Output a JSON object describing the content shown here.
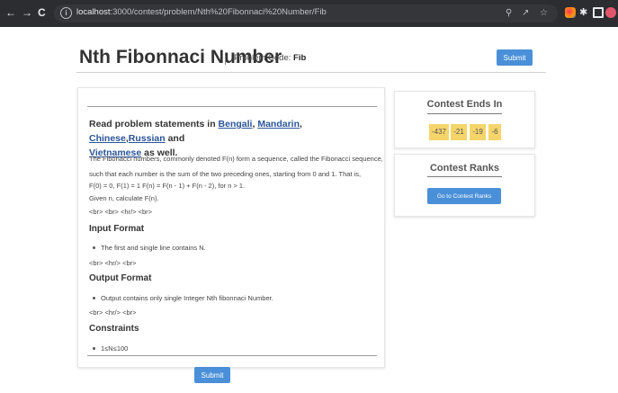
{
  "browser": {
    "url": "localhost:3000/contest/problem/Nth%20Fibonnaci%20Number/Fib",
    "url_host": "localhost",
    "url_path": ":3000/contest/problem/Nth%20Fibonnaci%20Number/Fib",
    "nav": {
      "back": "←",
      "forward": "→",
      "reload": "C"
    },
    "icons": [
      "search-icon",
      "share-icon",
      "star-icon",
      "extension-icon",
      "puzzle-icon",
      "sidebar-icon",
      "profile-icon"
    ]
  },
  "header": {
    "title": "Nth Fibonnaci Number",
    "code_label": "Problem Code:",
    "code": "Fib",
    "submit_label": "Submit"
  },
  "problem": {
    "read_prefix": "Read problem statements in",
    "languages": [
      "Bengali",
      "Mandarin",
      "Chinese",
      "Russian",
      "Vietnamese"
    ],
    "read_and": "and",
    "read_suffix": "as well.",
    "statement": [
      "The Fibonacci numbers, commonly denoted F(n) form a sequence, called the Fibonacci sequence,",
      "such that each number is the sum of the two preceding ones, starting from 0 and 1. That is,",
      "F(0) = 0, F(1) = 1 F(n) = F(n - 1) + F(n - 2), for n > 1.",
      "Given n, calculate F(n).",
      "<br> <br> <hr/> <br>"
    ],
    "input_heading": "Input Format",
    "input_bullet": "The first and single line contains N.",
    "input_tail": "<br> <hr/> <br>",
    "output_heading": "Output Format",
    "output_bullet": "Output contains only single Integer Nth fibonnaci Number.",
    "output_tail": "<br> <hr/> <br>",
    "constraints_heading": "Constraints",
    "constraint": "1≤N≤100",
    "submit_label": "Submit"
  },
  "contest": {
    "ends_title": "Contest Ends In",
    "timer": [
      "-437",
      "-21",
      "-19",
      "-6"
    ],
    "timer_color": "#f5d56a",
    "ranks_title": "Contest Ranks",
    "ranks_button": "Go to Contest Ranks"
  },
  "colors": {
    "primary": "#4a90d9",
    "link": "#2a5599",
    "chrome": "#2b2d31"
  }
}
